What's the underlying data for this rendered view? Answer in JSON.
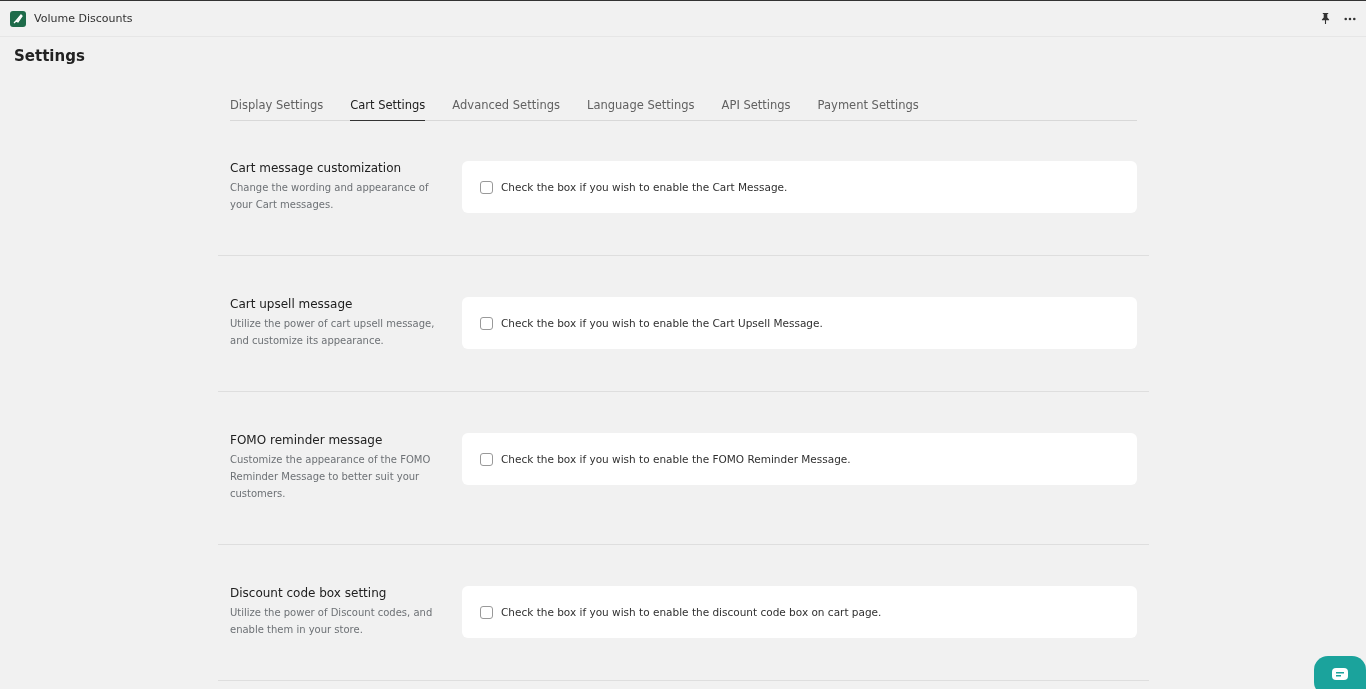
{
  "app": {
    "title": "Volume Discounts"
  },
  "page": {
    "title": "Settings"
  },
  "tabs": [
    {
      "label": "Display Settings",
      "selected": false
    },
    {
      "label": "Cart Settings",
      "selected": true
    },
    {
      "label": "Advanced Settings",
      "selected": false
    },
    {
      "label": "Language Settings",
      "selected": false
    },
    {
      "label": "API Settings",
      "selected": false
    },
    {
      "label": "Payment Settings",
      "selected": false
    }
  ],
  "sections": [
    {
      "title": "Cart message customization",
      "description": "Change the wording and appearance of your Cart messages.",
      "option": "Check the box if you wish to enable the Cart Message.",
      "checked": false
    },
    {
      "title": "Cart upsell message",
      "description": "Utilize the power of cart upsell message, and customize its appearance.",
      "option": "Check the box if you wish to enable the Cart Upsell Message.",
      "checked": false
    },
    {
      "title": "FOMO reminder message",
      "description": "Customize the appearance of the FOMO Reminder Message to better suit your customers.",
      "option": "Check the box if you wish to enable the FOMO Reminder Message.",
      "checked": false
    },
    {
      "title": "Discount code box setting",
      "description": "Utilize the power of Discount codes, and enable them in your store.",
      "option": "Check the box if you wish to enable the discount code box on cart page.",
      "checked": false
    }
  ]
}
